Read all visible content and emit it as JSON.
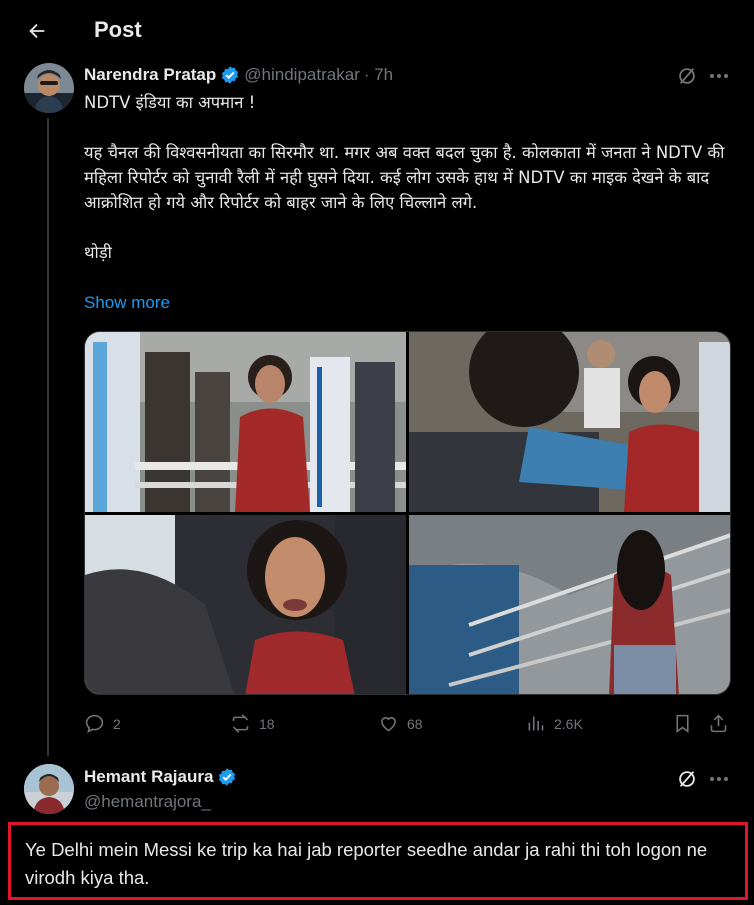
{
  "header": {
    "title": "Post"
  },
  "tweet": {
    "author_name": "Narendra Pratap",
    "handle": "@hindipatrakar",
    "time": "· 7h",
    "paragraphs": [
      "NDTV इंडिया का अपमान !",
      "यह चैनल की विश्वसनीयता का सिरमौर था. मगर अब वक्त बदल चुका है. कोलकाता में जनता ने NDTV की महिला रिपोर्टर को चुनावी रैली में नही घुसने दिया. कई लोग उसके हाथ में NDTV का माइक देखने के बाद आक्रोशित हो गये और रिपोर्टर को बाहर जाने के लिए चिल्लाने लगे.",
      "थोड़ी"
    ],
    "show_more": "Show more",
    "stats": {
      "replies": "2",
      "reposts": "18",
      "likes": "68",
      "views": "2.6K"
    }
  },
  "reply": {
    "author_name": "Hemant Rajaura",
    "handle": "@hemantrajora_",
    "text": "Ye Delhi mein Messi ke trip ka hai jab reporter seedhe andar ja rahi thi toh logon ne virodh kiya tha."
  },
  "colors": {
    "accent": "#1d9bf0",
    "muted": "#71767b",
    "highlight": "#e0162b",
    "background": "#000000"
  }
}
